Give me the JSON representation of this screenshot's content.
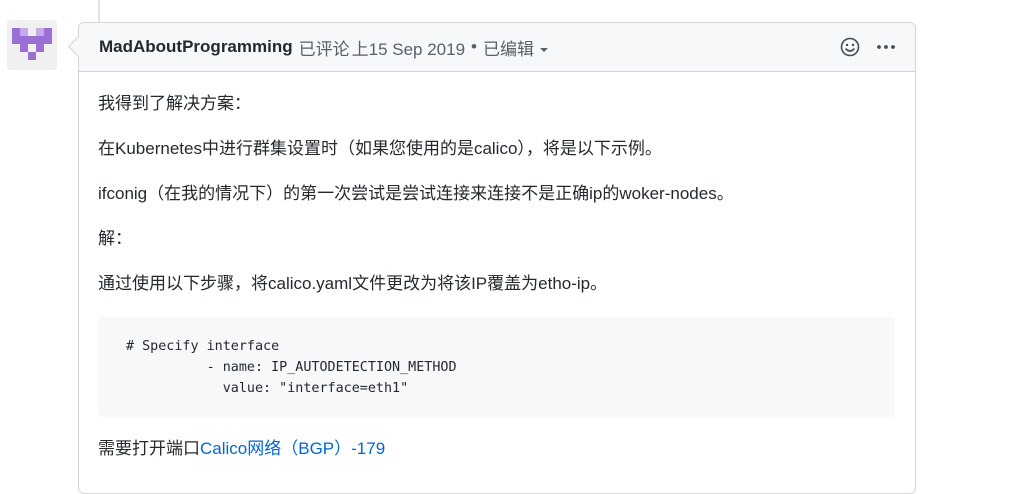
{
  "comment": {
    "author": "MadAboutProgramming",
    "action": "已评论",
    "date": "上15 Sep 2019",
    "separator": "•",
    "edited": "已编辑",
    "icons": {
      "reaction": "smiley-icon",
      "more": "kebab-icon",
      "edited_menu": "caret-down-icon",
      "avatar": "identicon-avatar"
    },
    "colors": {
      "avatar": "#9b6ed6",
      "link": "#0366d6"
    },
    "paragraphs": [
      "我得到了解决方案：",
      "在Kubernetes中进行群集设置时（如果您使用的是calico），将是以下示例。",
      "ifconig（在我的情况下）的第一次尝试是尝试连接来连接不是正确ip的woker-nodes。",
      "解：",
      "通过使用以下步骤，将calico.yaml文件更改为将该IP覆盖为etho-ip。"
    ],
    "code": {
      "line1": "# Specify interface",
      "line2": "          - name: IP_AUTODETECTION_METHOD",
      "line3": "            value: \"interface=eth1\""
    },
    "last_paragraph": {
      "text": "需要打开端口",
      "link_text": "Calico网络（BGP）-179"
    }
  }
}
